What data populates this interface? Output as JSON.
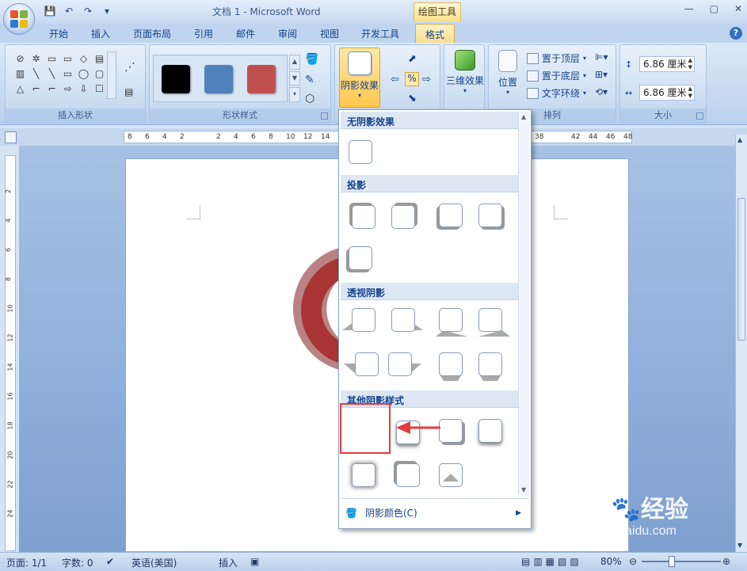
{
  "window": {
    "title": "文档 1 - Microsoft Word",
    "context_group": "绘图工具"
  },
  "tabs": [
    "开始",
    "插入",
    "页面布局",
    "引用",
    "邮件",
    "审阅",
    "视图",
    "开发工具",
    "格式"
  ],
  "active_tab": "格式",
  "ribbon": {
    "groups": {
      "insert_shapes": "插入形状",
      "shape_styles": "形状样式",
      "arrange": "排列",
      "size": "大小"
    },
    "shadow_button_label": "阴影效果",
    "threed_button_label": "三维效果",
    "position_label": "位置",
    "bring_front": "置于顶层",
    "send_back": "置于底层",
    "text_wrap": "文字环绕",
    "height_value": "6.86 厘米",
    "width_value": "6.86 厘米",
    "style_colors": [
      "#000000",
      "#4f81bd",
      "#c0504d"
    ]
  },
  "ruler": {
    "h_left": [
      "8",
      "6",
      "4",
      "2",
      "2",
      "4",
      "6",
      "8",
      "10",
      "12",
      "14"
    ],
    "h_right": [
      "38",
      "42",
      "44",
      "46",
      "48"
    ],
    "v": [
      "2",
      "4",
      "6",
      "8",
      "10",
      "12",
      "14",
      "16",
      "18",
      "20",
      "22",
      "24"
    ]
  },
  "dropdown": {
    "sections": [
      "无阴影效果",
      "投影",
      "透视阴影",
      "其他阴影样式"
    ],
    "footer_label": "阴影颜色(C)"
  },
  "statusbar": {
    "page": "页面: 1/1",
    "words": "字数: 0",
    "language": "英语(美国)",
    "mode": "插入",
    "zoom": "80%"
  },
  "watermark": {
    "brand": "Bai",
    "brand_cn": "经验",
    "url": "jingyan.baidu.com"
  },
  "colors": {
    "accent": "#15428b",
    "highlight": "#f7a53a",
    "annotation": "#e53a3a"
  }
}
